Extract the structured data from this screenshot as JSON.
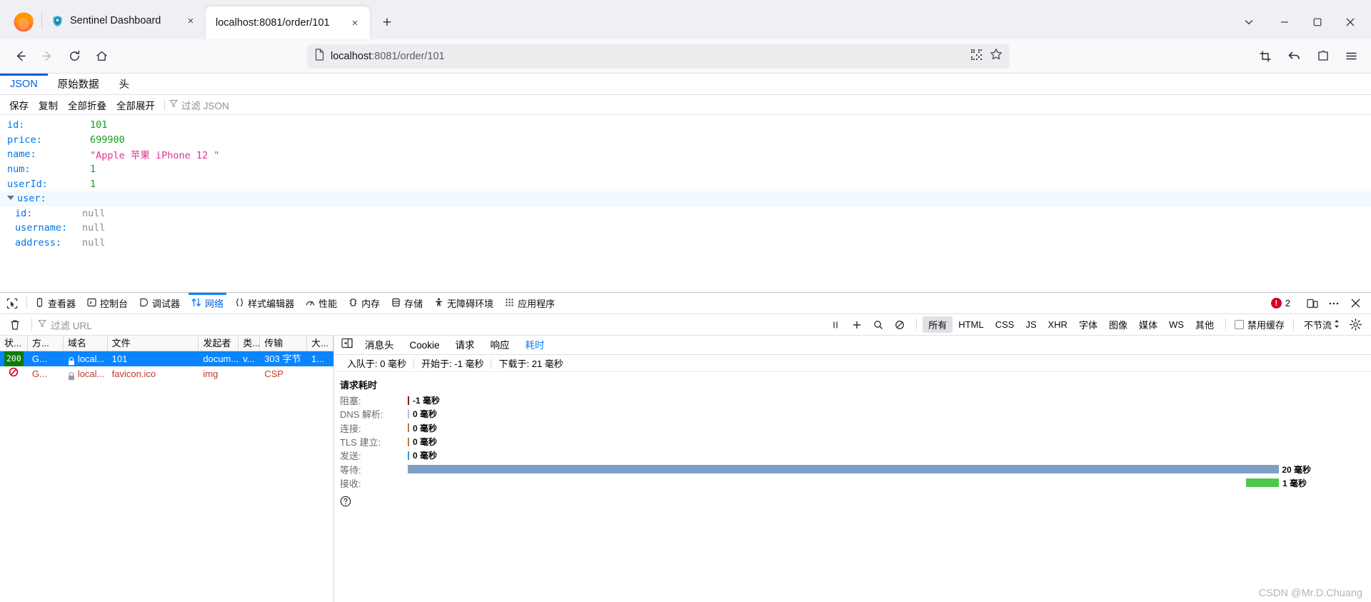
{
  "window": {
    "controls": {
      "chevron": "chevron-down",
      "minimize": "minimize",
      "maximize": "maximize",
      "close": "close"
    }
  },
  "tabs": [
    {
      "title": "Sentinel Dashboard",
      "active": false,
      "favicon": "sentinel-shield-icon",
      "close_label": "×"
    },
    {
      "title": "localhost:8081/order/101",
      "active": true,
      "favicon": "none",
      "close_label": "×"
    }
  ],
  "newtab_label": "+",
  "navbar": {
    "back": "←",
    "forward": "→",
    "reload": "↻",
    "home": "home-icon",
    "url_host": "localhost",
    "url_rest": ":8081/order/101",
    "url_full": "localhost:8081/order/101",
    "page_icon": "page-document-icon",
    "qr_icon": "qr-code-icon",
    "bookmark_icon": "star-icon",
    "right_icons": [
      "screenshot-icon",
      "undo-arrow-icon",
      "extensions-icon",
      "app-menu-icon"
    ]
  },
  "json_viewer": {
    "tabs": [
      {
        "label": "JSON",
        "active": true
      },
      {
        "label": "原始数据",
        "active": false
      },
      {
        "label": "头",
        "active": false
      }
    ],
    "toolbar": {
      "save": "保存",
      "copy": "复制",
      "collapse_all": "全部折叠",
      "expand_all": "全部展开",
      "filter_placeholder": "过滤 JSON",
      "filter_icon": "funnel-icon"
    },
    "rows": [
      {
        "key": "id:",
        "value": "101",
        "type": "num",
        "indent": 0
      },
      {
        "key": "price:",
        "value": "699900",
        "type": "num",
        "indent": 0
      },
      {
        "key": "name:",
        "value": "\"Apple 苹果 iPhone 12 \"",
        "type": "str",
        "indent": 0
      },
      {
        "key": "num:",
        "value": "1",
        "type": "num",
        "indent": 0
      },
      {
        "key": "userId:",
        "value": "1",
        "type": "num",
        "indent": 0
      },
      {
        "key": "user:",
        "value": "",
        "type": "obj",
        "indent": 0
      },
      {
        "key": "id:",
        "value": "null",
        "type": "null",
        "indent": 1
      },
      {
        "key": "username:",
        "value": "null",
        "type": "null",
        "indent": 1
      },
      {
        "key": "address:",
        "value": "null",
        "type": "null",
        "indent": 1
      }
    ]
  },
  "devtools": {
    "picker_icon": "element-picker-icon",
    "tabs": [
      {
        "label": "查看器",
        "icon": "inspector-icon",
        "active": false
      },
      {
        "label": "控制台",
        "icon": "console-icon",
        "active": false
      },
      {
        "label": "调试器",
        "icon": "debugger-icon",
        "active": false
      },
      {
        "label": "网络",
        "icon": "network-icon",
        "active": true
      },
      {
        "label": "样式编辑器",
        "icon": "style-editor-icon",
        "active": false
      },
      {
        "label": "性能",
        "icon": "performance-icon",
        "active": false
      },
      {
        "label": "内存",
        "icon": "memory-icon",
        "active": false
      },
      {
        "label": "存储",
        "icon": "storage-icon",
        "active": false
      },
      {
        "label": "无障碍环境",
        "icon": "accessibility-icon",
        "active": false
      },
      {
        "label": "应用程序",
        "icon": "application-icon",
        "active": false
      }
    ],
    "error_count": "2",
    "right_icons": [
      "responsive-design-mode-icon",
      "more-options-icon",
      "close-devtools-icon"
    ]
  },
  "network_toolbar": {
    "trash_icon": "trash-icon",
    "filter_icon": "funnel-icon",
    "filter_placeholder": "过滤 URL",
    "pause_icon": "pause-icon",
    "add_icon": "plus-icon",
    "search_icon": "search-icon",
    "block_icon": "no-entry-icon",
    "types": [
      {
        "label": "所有",
        "selected": true
      },
      {
        "label": "HTML",
        "selected": false
      },
      {
        "label": "CSS",
        "selected": false
      },
      {
        "label": "JS",
        "selected": false
      },
      {
        "label": "XHR",
        "selected": false
      },
      {
        "label": "字体",
        "selected": false
      },
      {
        "label": "图像",
        "selected": false
      },
      {
        "label": "媒体",
        "selected": false
      },
      {
        "label": "WS",
        "selected": false
      },
      {
        "label": "其他",
        "selected": false
      }
    ],
    "disable_cache_label": "禁用缓存",
    "disable_cache_checked": false,
    "throttle_label": "不节流",
    "settings_icon": "gear-icon"
  },
  "request_table": {
    "columns": [
      "状...",
      "方...",
      "域名",
      "文件",
      "发起者",
      "类...",
      "传输",
      "大..."
    ],
    "rows": [
      {
        "status": "200",
        "status_kind": "ok",
        "method": "G...",
        "domain": "local...",
        "file": "101",
        "initiator": "docum...",
        "type": "v...",
        "transferred": "303 字节",
        "size": "1...",
        "selected": true,
        "secure": true
      },
      {
        "status": "blocked-icon",
        "status_kind": "blocked",
        "method": "G...",
        "domain": "local...",
        "file": "favicon.ico",
        "initiator": "img",
        "type": "",
        "transferred": "CSP",
        "size": "",
        "selected": false,
        "secure": true
      }
    ]
  },
  "request_detail": {
    "expand_icon": "expand-panel-icon",
    "tabs": [
      {
        "label": "消息头",
        "active": false
      },
      {
        "label": "Cookie",
        "active": false
      },
      {
        "label": "请求",
        "active": false
      },
      {
        "label": "响应",
        "active": false
      },
      {
        "label": "耗时",
        "active": true
      }
    ],
    "summary": [
      "入队于: 0 毫秒",
      "开始于: -1 毫秒",
      "下载于: 21 毫秒"
    ],
    "section_title": "请求耗时",
    "help_icon": "help-circle-icon",
    "timings": [
      {
        "label": "阻塞:",
        "value": "-1 毫秒",
        "color": "#7a1b2b",
        "left_pct": 0,
        "width_pct": 0.2
      },
      {
        "label": "DNS 解析:",
        "value": "0 毫秒",
        "color": "#d8a8e8",
        "left_pct": 0,
        "width_pct": 0.2
      },
      {
        "label": "连接:",
        "value": "0 毫秒",
        "color": "#c07838",
        "left_pct": 0,
        "width_pct": 0.2
      },
      {
        "label": "TLS 建立:",
        "value": "0 毫秒",
        "color": "#c07838",
        "left_pct": 0,
        "width_pct": 0.2
      },
      {
        "label": "发送:",
        "value": "0 毫秒",
        "color": "#3a9ad9",
        "left_pct": 0,
        "width_pct": 0.2
      },
      {
        "label": "等待:",
        "value": "20 毫秒",
        "color": "#7fa0c6",
        "left_pct": 0,
        "width_pct": 86.5
      },
      {
        "label": "接收:",
        "value": "1 毫秒",
        "color": "#4ec94e",
        "left_pct": 83.0,
        "width_pct": 3.5
      }
    ]
  },
  "watermark": "CSDN @Mr.D.Chuang"
}
